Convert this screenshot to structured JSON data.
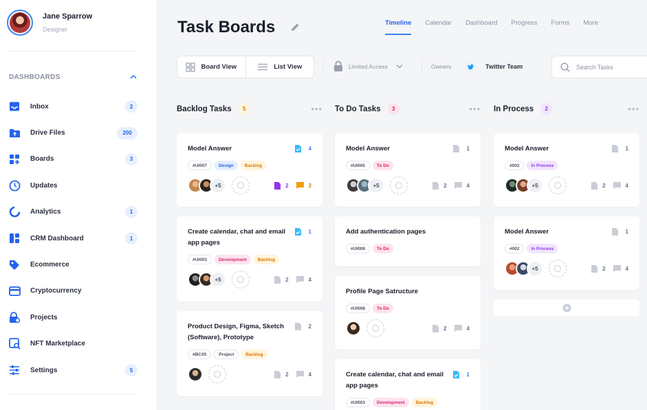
{
  "user": {
    "name": "Jane Sparrow",
    "role": "Designer"
  },
  "sidebar": {
    "section_title": "DASHBOARDS",
    "items": [
      {
        "label": "Inbox",
        "badge": "2",
        "icon": "inbox-icon"
      },
      {
        "label": "Drive Files",
        "badge": "200",
        "icon": "folder-upload-icon"
      },
      {
        "label": "Boards",
        "badge": "3",
        "icon": "grid-plus-icon"
      },
      {
        "label": "Updates",
        "badge": "",
        "icon": "clock-icon"
      },
      {
        "label": "Analytics",
        "badge": "1",
        "icon": "pie-ring-icon"
      },
      {
        "label": "CRM Dashboard",
        "badge": "1",
        "icon": "layout-icon"
      },
      {
        "label": "Ecommerce",
        "badge": "",
        "icon": "tag-icon"
      },
      {
        "label": "Cryptocurrency",
        "badge": "",
        "icon": "credit-card-icon"
      },
      {
        "label": "Projects",
        "badge": "",
        "icon": "lock-user-icon"
      },
      {
        "label": "NFT Marketplace",
        "badge": "",
        "icon": "image-search-icon"
      },
      {
        "label": "Settings",
        "badge": "5",
        "icon": "sliders-icon"
      }
    ]
  },
  "header": {
    "title": "Task Boards",
    "tabs": [
      "Timeline",
      "Calendar",
      "Dashboard",
      "Progress",
      "Forms",
      "More"
    ],
    "active_tab": "Timeline"
  },
  "toolbar": {
    "board_view": "Board View",
    "list_view": "List View",
    "access": "Limited Access",
    "owners_label": "Owners",
    "owner_team": "Twitter Team",
    "search_placeholder": "Search Tasks"
  },
  "colors": {
    "accent": "#3b82f6",
    "backlog": "#f59e0b",
    "todo": "#e11d48",
    "inprocess": "#9333ea"
  },
  "columns": [
    {
      "title": "Backlog Tasks",
      "count": "5",
      "cards": [
        {
          "title": "Model Answer",
          "top_value": "4",
          "tags": [
            "#UI007",
            "Design",
            "Backlog"
          ],
          "more": "+5",
          "files": "2",
          "comments": "3"
        },
        {
          "title": "Create calendar, chat and email app pages",
          "top_value": "1",
          "tags": [
            "#UI003",
            "Development",
            "Backlog"
          ],
          "more": "+5",
          "files": "2",
          "comments": "4"
        },
        {
          "title": "Product Design, Figma, Sketch (Software), Prototype",
          "top_value": "2",
          "tags": [
            "#BC05",
            "Project",
            "Backlog"
          ],
          "more": "",
          "files": "2",
          "comments": "4"
        }
      ]
    },
    {
      "title": "To Do Tasks",
      "count": "3",
      "cards": [
        {
          "title": "Model Answer",
          "top_value": "1",
          "tags": [
            "#UI005",
            "To Do"
          ],
          "more": "+5",
          "files": "2",
          "comments": "4"
        },
        {
          "title": "Add authentication pages",
          "top_value": "",
          "tags": [
            "#UI008",
            "To Do"
          ],
          "more": "",
          "files": "",
          "comments": ""
        },
        {
          "title": "Profile Page Satructure",
          "top_value": "",
          "tags": [
            "#UI008",
            "To Do"
          ],
          "more": "",
          "files": "2",
          "comments": "4"
        },
        {
          "title": "Create calendar, chat and email app pages",
          "top_value": "1",
          "tags": [
            "#UI003",
            "Development",
            "Backlog"
          ],
          "more": "",
          "files": "",
          "comments": ""
        }
      ]
    },
    {
      "title": "In Process",
      "count": "2",
      "cards": [
        {
          "title": "Model Answer",
          "top_value": "1",
          "tags": [
            "#002",
            "In Process"
          ],
          "more": "+5",
          "files": "2",
          "comments": "4"
        },
        {
          "title": "Model Answer",
          "top_value": "1",
          "tags": [
            "#002",
            "In Process"
          ],
          "more": "+5",
          "files": "2",
          "comments": "4"
        }
      ]
    }
  ]
}
